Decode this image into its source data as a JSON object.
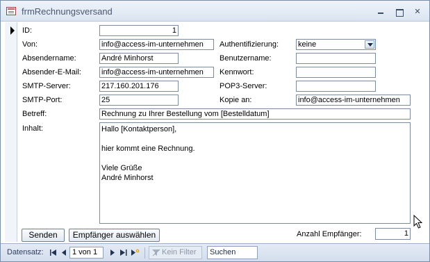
{
  "window": {
    "title": "frmRechnungsversand",
    "min_icon": "minimize-icon",
    "max_icon": "maximize-icon",
    "close_symbol": "✕"
  },
  "form": {
    "id_label": "ID:",
    "id_value": "1",
    "von_label": "Von:",
    "von_value": "info@access-im-unternehmen",
    "auth_label": "Authentifizierung:",
    "auth_value": "keine",
    "absendername_label": "Absendername:",
    "absendername_value": "André Minhorst",
    "benutzername_label": "Benutzername:",
    "benutzername_value": "",
    "absender_email_label": "Absender-E-Mail:",
    "absender_email_value": "info@access-im-unternehmen",
    "kennwort_label": "Kennwort:",
    "kennwort_value": "",
    "smtp_server_label": "SMTP-Server:",
    "smtp_server_value": "217.160.201.176",
    "pop3_label": "POP3-Server:",
    "pop3_value": "",
    "smtp_port_label": "SMTP-Port:",
    "smtp_port_value": "25",
    "kopie_label": "Kopie an:",
    "kopie_value": "info@access-im-unternehmen",
    "betreff_label": "Betreff:",
    "betreff_value": "Rechnung zu Ihrer Bestellung vom [Bestelldatum]",
    "inhalt_label": "Inhalt:",
    "inhalt_value": "Hallo [Kontaktperson],\n\nhier kommt eine Rechnung.\n\nViele Grüße\nAndré Minhorst",
    "send_button": "Senden",
    "recipients_button": "Empfänger auswählen",
    "anzahl_label": "Anzahl Empfänger:",
    "anzahl_value": "1"
  },
  "navbar": {
    "label": "Datensatz:",
    "current": "1 von 1",
    "filter_label": "Kein Filter",
    "search_label": "Suchen",
    "icons": [
      "first-record-icon",
      "previous-record-icon",
      "next-record-icon",
      "last-record-icon",
      "new-record-icon",
      "filter-icon"
    ]
  }
}
